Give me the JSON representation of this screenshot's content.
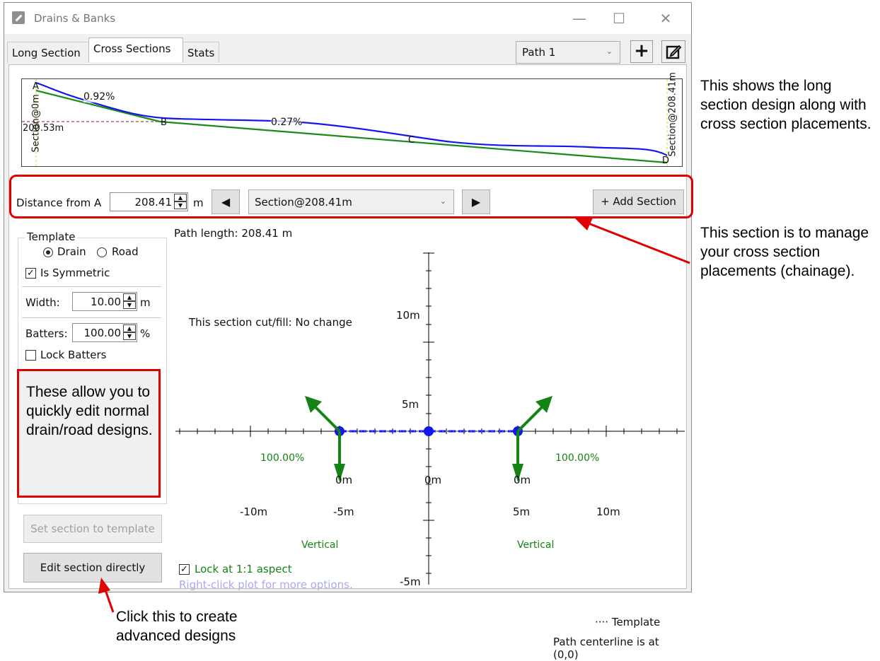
{
  "window": {
    "title": "Drains & Banks",
    "minimize": "—",
    "maximize": "☐",
    "close": "✕"
  },
  "tabs": [
    {
      "label": "Long Section"
    },
    {
      "label": "Cross Sections"
    },
    {
      "label": "Stats"
    }
  ],
  "path_select": {
    "value": "Path 1"
  },
  "toolbar": {
    "add_glyph": "+",
    "edit_glyph": "✎"
  },
  "long_section": {
    "labels": {
      "a": "A",
      "b": "B",
      "c": "C",
      "d": "D",
      "grade1": "0.92%",
      "grade2": "0.27%",
      "elev": "200.53m",
      "start_section": "Section@0m",
      "end_section": "Section@208.41m"
    }
  },
  "section_nav": {
    "distance_label": "Distance from A",
    "distance_value": "208.41",
    "unit": "m",
    "prev_glyph": "◀",
    "next_glyph": "▶",
    "section_value": "Section@208.41m",
    "add_label": "+ Add Section"
  },
  "template": {
    "group_label": "Template",
    "drain_label": "Drain",
    "road_label": "Road",
    "drain_selected": true,
    "symmetric_label": "Is Symmetric",
    "symmetric_checked": true,
    "width_label": "Width:",
    "width_value": "10.00",
    "width_unit": "m",
    "batters_label": "Batters:",
    "batters_value": "100.00",
    "batters_unit": "%",
    "lock_batters_label": "Lock Batters",
    "lock_batters_checked": false
  },
  "buttons": {
    "set_template": "Set section to template",
    "edit_directly": "Edit section directly"
  },
  "plot": {
    "path_length": "Path length: 208.41 m",
    "cut_fill": "This section cut/fill: No change",
    "y_ticks": [
      "10m",
      "5m",
      "-5m"
    ],
    "x_ticks": [
      "-10m",
      "-5m",
      "5m",
      "10m"
    ],
    "point_labels": [
      "0m",
      "0m",
      "0m"
    ],
    "batter_labels": [
      "100.00%",
      "100.00%"
    ],
    "vertical_labels": [
      "Vertical",
      "Vertical"
    ],
    "legend": "···· Template",
    "centerline": "Path centerline is at (0,0)",
    "lock_aspect_label": "Lock at 1:1 aspect",
    "lock_aspect_checked": true,
    "hint": "Right-click plot for more options."
  },
  "callouts": {
    "long_section": "This shows the long section design along with cross section placements.",
    "section_manage": "This section is to manage your cross section placements (chainage).",
    "template_edit": "These allow you to quickly edit normal drain/road designs.",
    "advanced": "Click this to create advanced designs"
  },
  "colors": {
    "accent_red": "#e00000",
    "design_green": "#148214",
    "terrain_blue": "#1515ee"
  }
}
